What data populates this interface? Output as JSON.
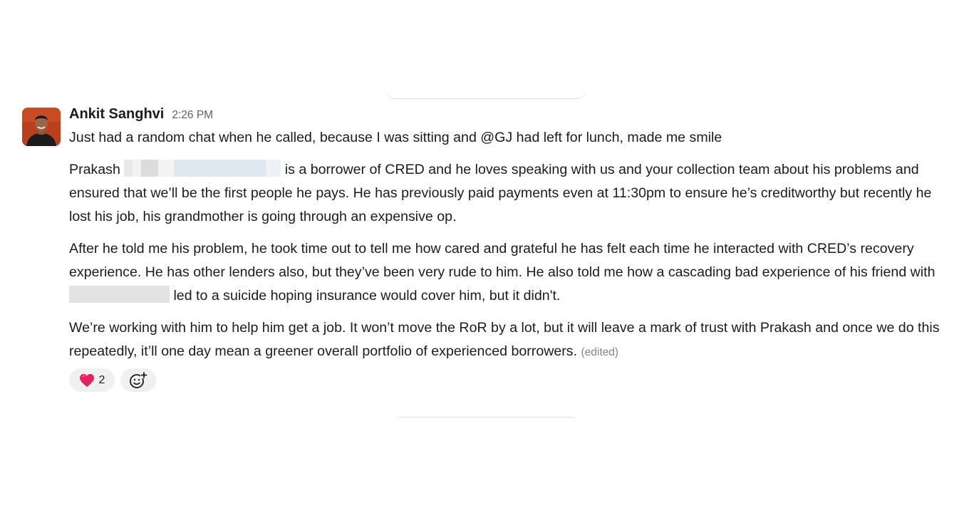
{
  "message": {
    "author": "Ankit Sanghvi",
    "time": "2:26 PM",
    "line1": "Just had a random chat when he called, because I was sitting and @GJ had left for lunch, made me smile",
    "para2_start": "Prakash",
    "para2_rest": "is a borrower of CRED and he loves speaking with us and your collection team about his problems and ensured that we’ll be the first people he pays. He has previously paid payments even at 11:30pm to ensure he’s creditworthy but recently he lost his job, his grandmother is going through an expensive op.",
    "para3_start": "After he told me his problem, he took time out to tell me how cared and grateful he has felt each time he interacted with CRED’s recovery experience. He has other lenders also, but they’ve been very rude to him. He also told me how a cascading bad experience of his friend with",
    "para3_end": "led to a suicide hoping insurance would cover him, but it didn't.",
    "para4": "We’re working with him to help him get a job. It won’t move the RoR by a lot, but it will leave a mark of trust with Prakash and once we do this repeatedly, it’ll one day mean a greener overall portfolio of experienced borrowers.",
    "edited": "(edited)"
  },
  "reactions": [
    {
      "emoji": "heart-emoji",
      "count": "2"
    },
    {
      "emoji": "add-reaction-icon"
    }
  ],
  "colors": {
    "text": "#1d1c1d",
    "muted": "#616061",
    "reaction_bg": "#f0f0f0",
    "heart": "#e0245e",
    "avatar_bg": "#b8401e"
  }
}
